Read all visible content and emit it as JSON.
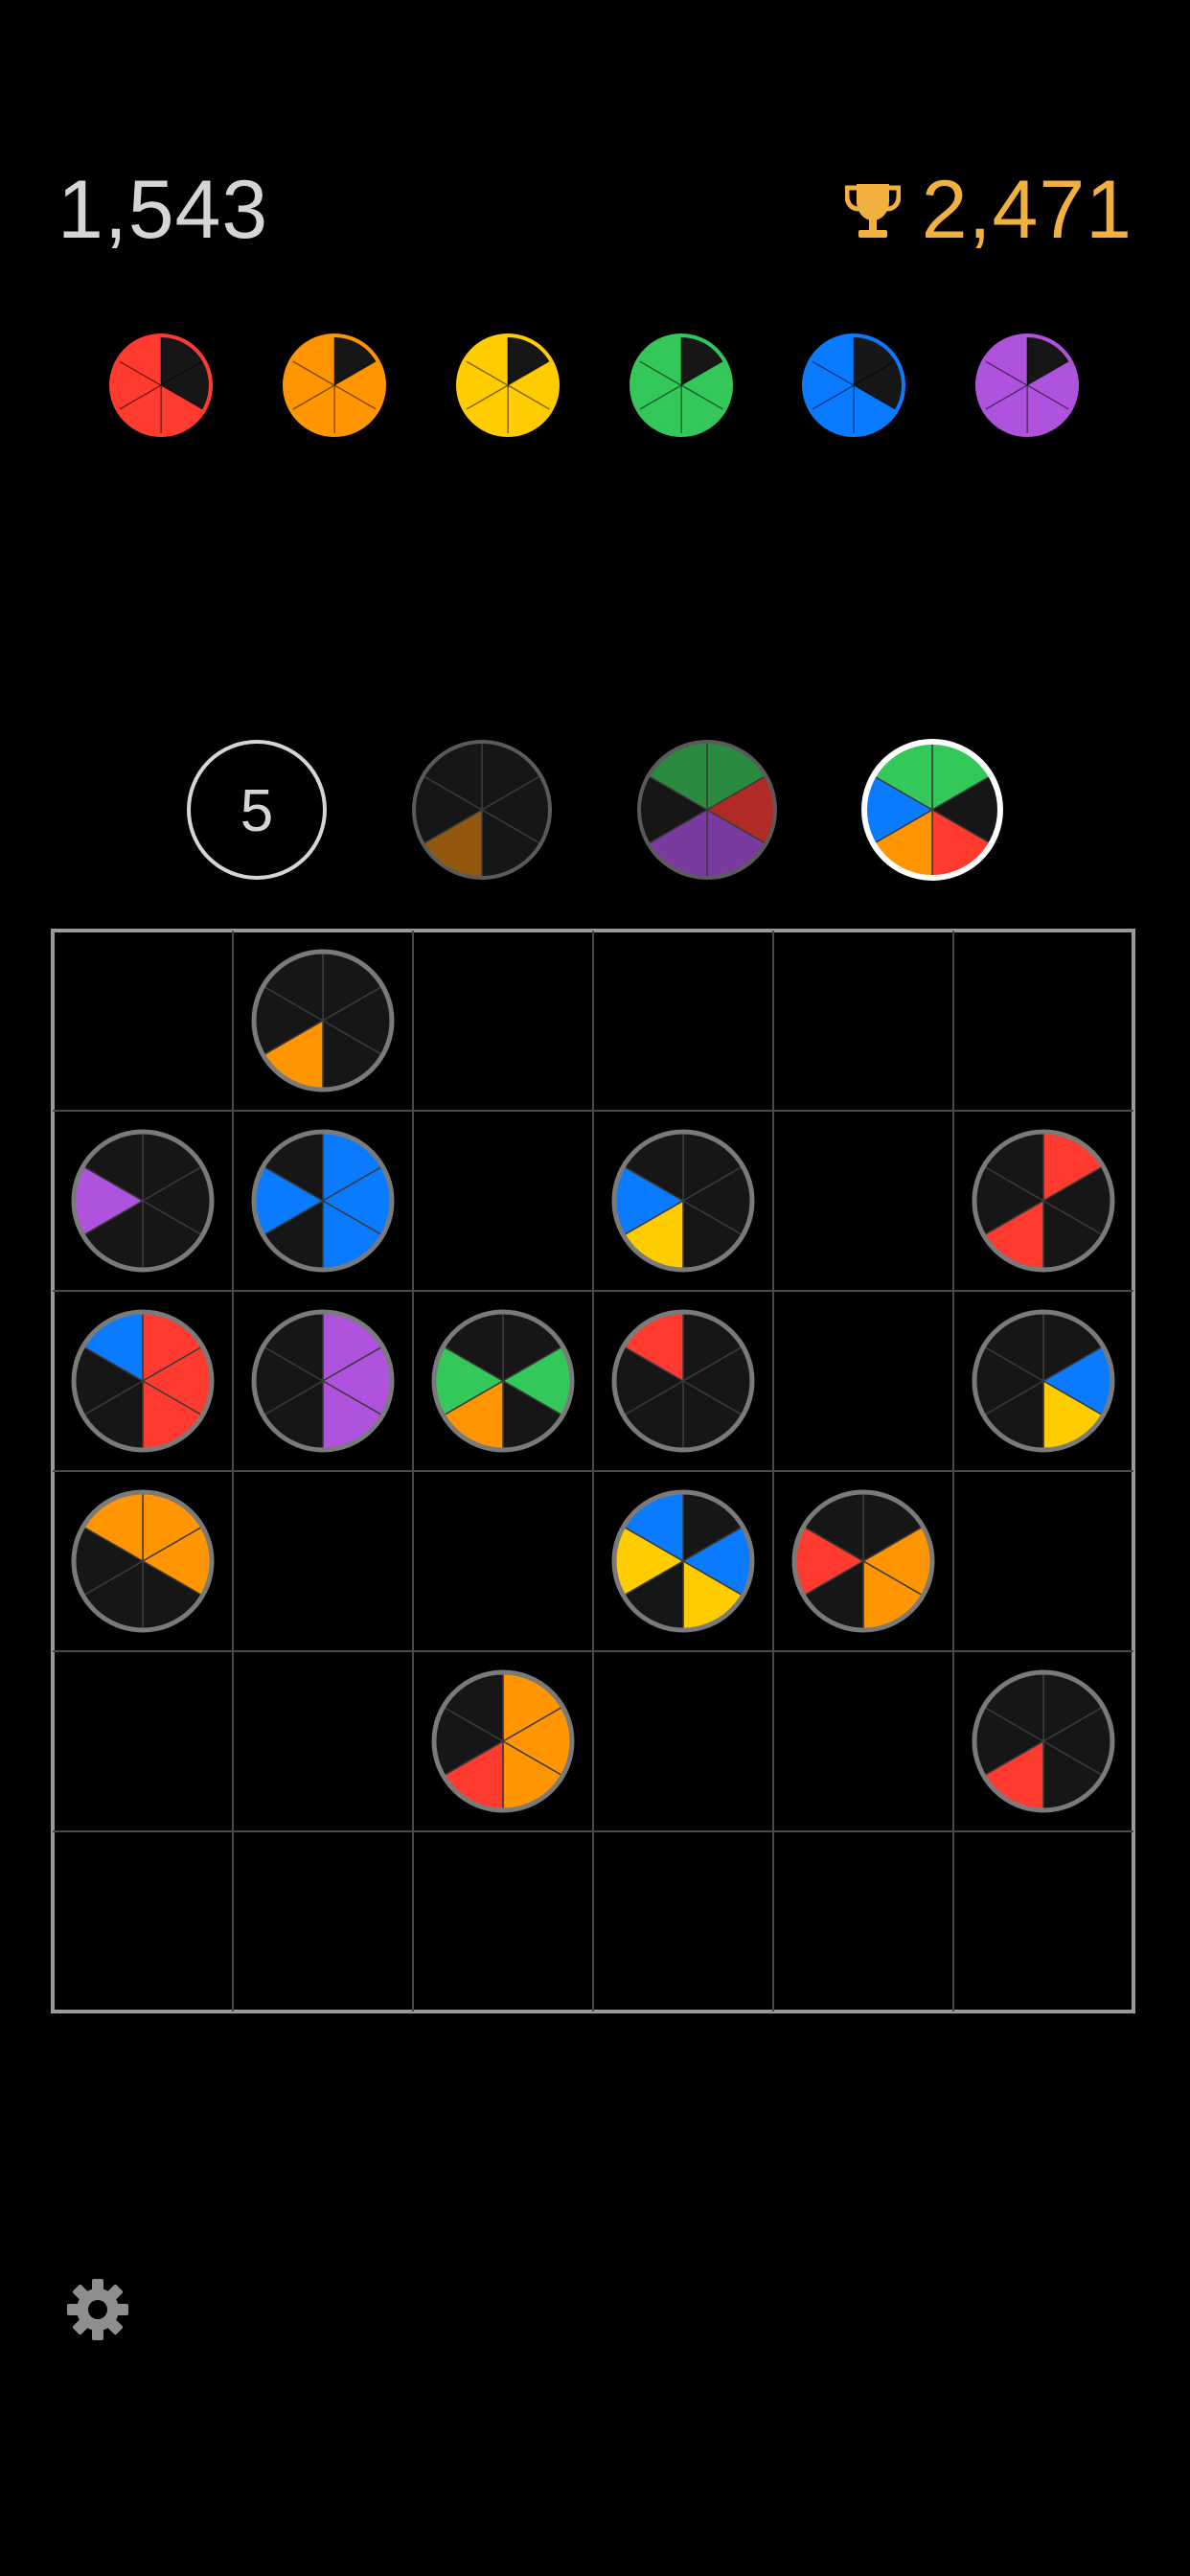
{
  "header": {
    "score": "1,543",
    "best_score": "2,471",
    "trophy_icon": "trophy-icon",
    "trophy_color": "#f2b13f"
  },
  "palette": {
    "red": "#ff3b30",
    "orange": "#ff9500",
    "yellow": "#ffcc00",
    "green": "#34c759",
    "blue": "#0a7aff",
    "purple": "#af52de",
    "dim_orange": "#93570e",
    "dim_green": "#2a8a3f",
    "dim_red": "#b02a26",
    "dim_purple": "#7a3aa0",
    "empty": "#161616"
  },
  "progress": [
    {
      "name": "red",
      "filled": 4
    },
    {
      "name": "orange",
      "filled": 5
    },
    {
      "name": "yellow",
      "filled": 5
    },
    {
      "name": "green",
      "filled": 5
    },
    {
      "name": "blue",
      "filled": 4
    },
    {
      "name": "purple",
      "filled": 5
    }
  ],
  "queue": [
    {
      "type": "counter",
      "label": "5"
    },
    {
      "type": "piece",
      "segments": [
        "empty",
        "empty",
        "empty",
        "dim_orange",
        "empty",
        "empty"
      ],
      "selected": false
    },
    {
      "type": "piece",
      "segments": [
        "dim_green",
        "dim_red",
        "dim_purple",
        "dim_purple",
        "empty",
        "dim_green"
      ],
      "selected": false
    },
    {
      "type": "piece",
      "segments": [
        "green",
        "empty",
        "red",
        "orange",
        "blue",
        "green"
      ],
      "selected": true
    }
  ],
  "grid": {
    "rows": 6,
    "cols": 6,
    "pieces": [
      {
        "r": 0,
        "c": 1,
        "segments": [
          "empty",
          "empty",
          "empty",
          "orange",
          "empty",
          "empty"
        ]
      },
      {
        "r": 1,
        "c": 0,
        "segments": [
          "empty",
          "empty",
          "empty",
          "empty",
          "purple",
          "empty"
        ]
      },
      {
        "r": 1,
        "c": 1,
        "segments": [
          "blue",
          "blue",
          "blue",
          "empty",
          "blue",
          "empty"
        ]
      },
      {
        "r": 1,
        "c": 3,
        "segments": [
          "empty",
          "empty",
          "empty",
          "yellow",
          "blue",
          "empty"
        ]
      },
      {
        "r": 1,
        "c": 5,
        "segments": [
          "red",
          "empty",
          "empty",
          "red",
          "empty",
          "empty"
        ]
      },
      {
        "r": 2,
        "c": 0,
        "segments": [
          "red",
          "red",
          "red",
          "empty",
          "empty",
          "blue"
        ]
      },
      {
        "r": 2,
        "c": 1,
        "segments": [
          "purple",
          "purple",
          "purple",
          "empty",
          "empty",
          "empty"
        ]
      },
      {
        "r": 2,
        "c": 2,
        "segments": [
          "empty",
          "green",
          "empty",
          "orange",
          "green",
          "empty"
        ]
      },
      {
        "r": 2,
        "c": 3,
        "segments": [
          "empty",
          "empty",
          "empty",
          "empty",
          "empty",
          "red"
        ]
      },
      {
        "r": 2,
        "c": 5,
        "segments": [
          "empty",
          "blue",
          "yellow",
          "empty",
          "empty",
          "empty"
        ]
      },
      {
        "r": 3,
        "c": 0,
        "segments": [
          "orange",
          "orange",
          "empty",
          "empty",
          "empty",
          "orange"
        ]
      },
      {
        "r": 3,
        "c": 3,
        "segments": [
          "empty",
          "blue",
          "yellow",
          "empty",
          "yellow",
          "blue"
        ]
      },
      {
        "r": 3,
        "c": 4,
        "segments": [
          "empty",
          "orange",
          "orange",
          "empty",
          "red",
          "empty"
        ]
      },
      {
        "r": 4,
        "c": 2,
        "segments": [
          "orange",
          "orange",
          "orange",
          "red",
          "empty",
          "empty"
        ]
      },
      {
        "r": 4,
        "c": 5,
        "segments": [
          "empty",
          "empty",
          "empty",
          "red",
          "empty",
          "empty"
        ]
      }
    ]
  },
  "footer": {
    "settings_icon": "gear-icon",
    "settings_color": "#8e8e8e"
  }
}
